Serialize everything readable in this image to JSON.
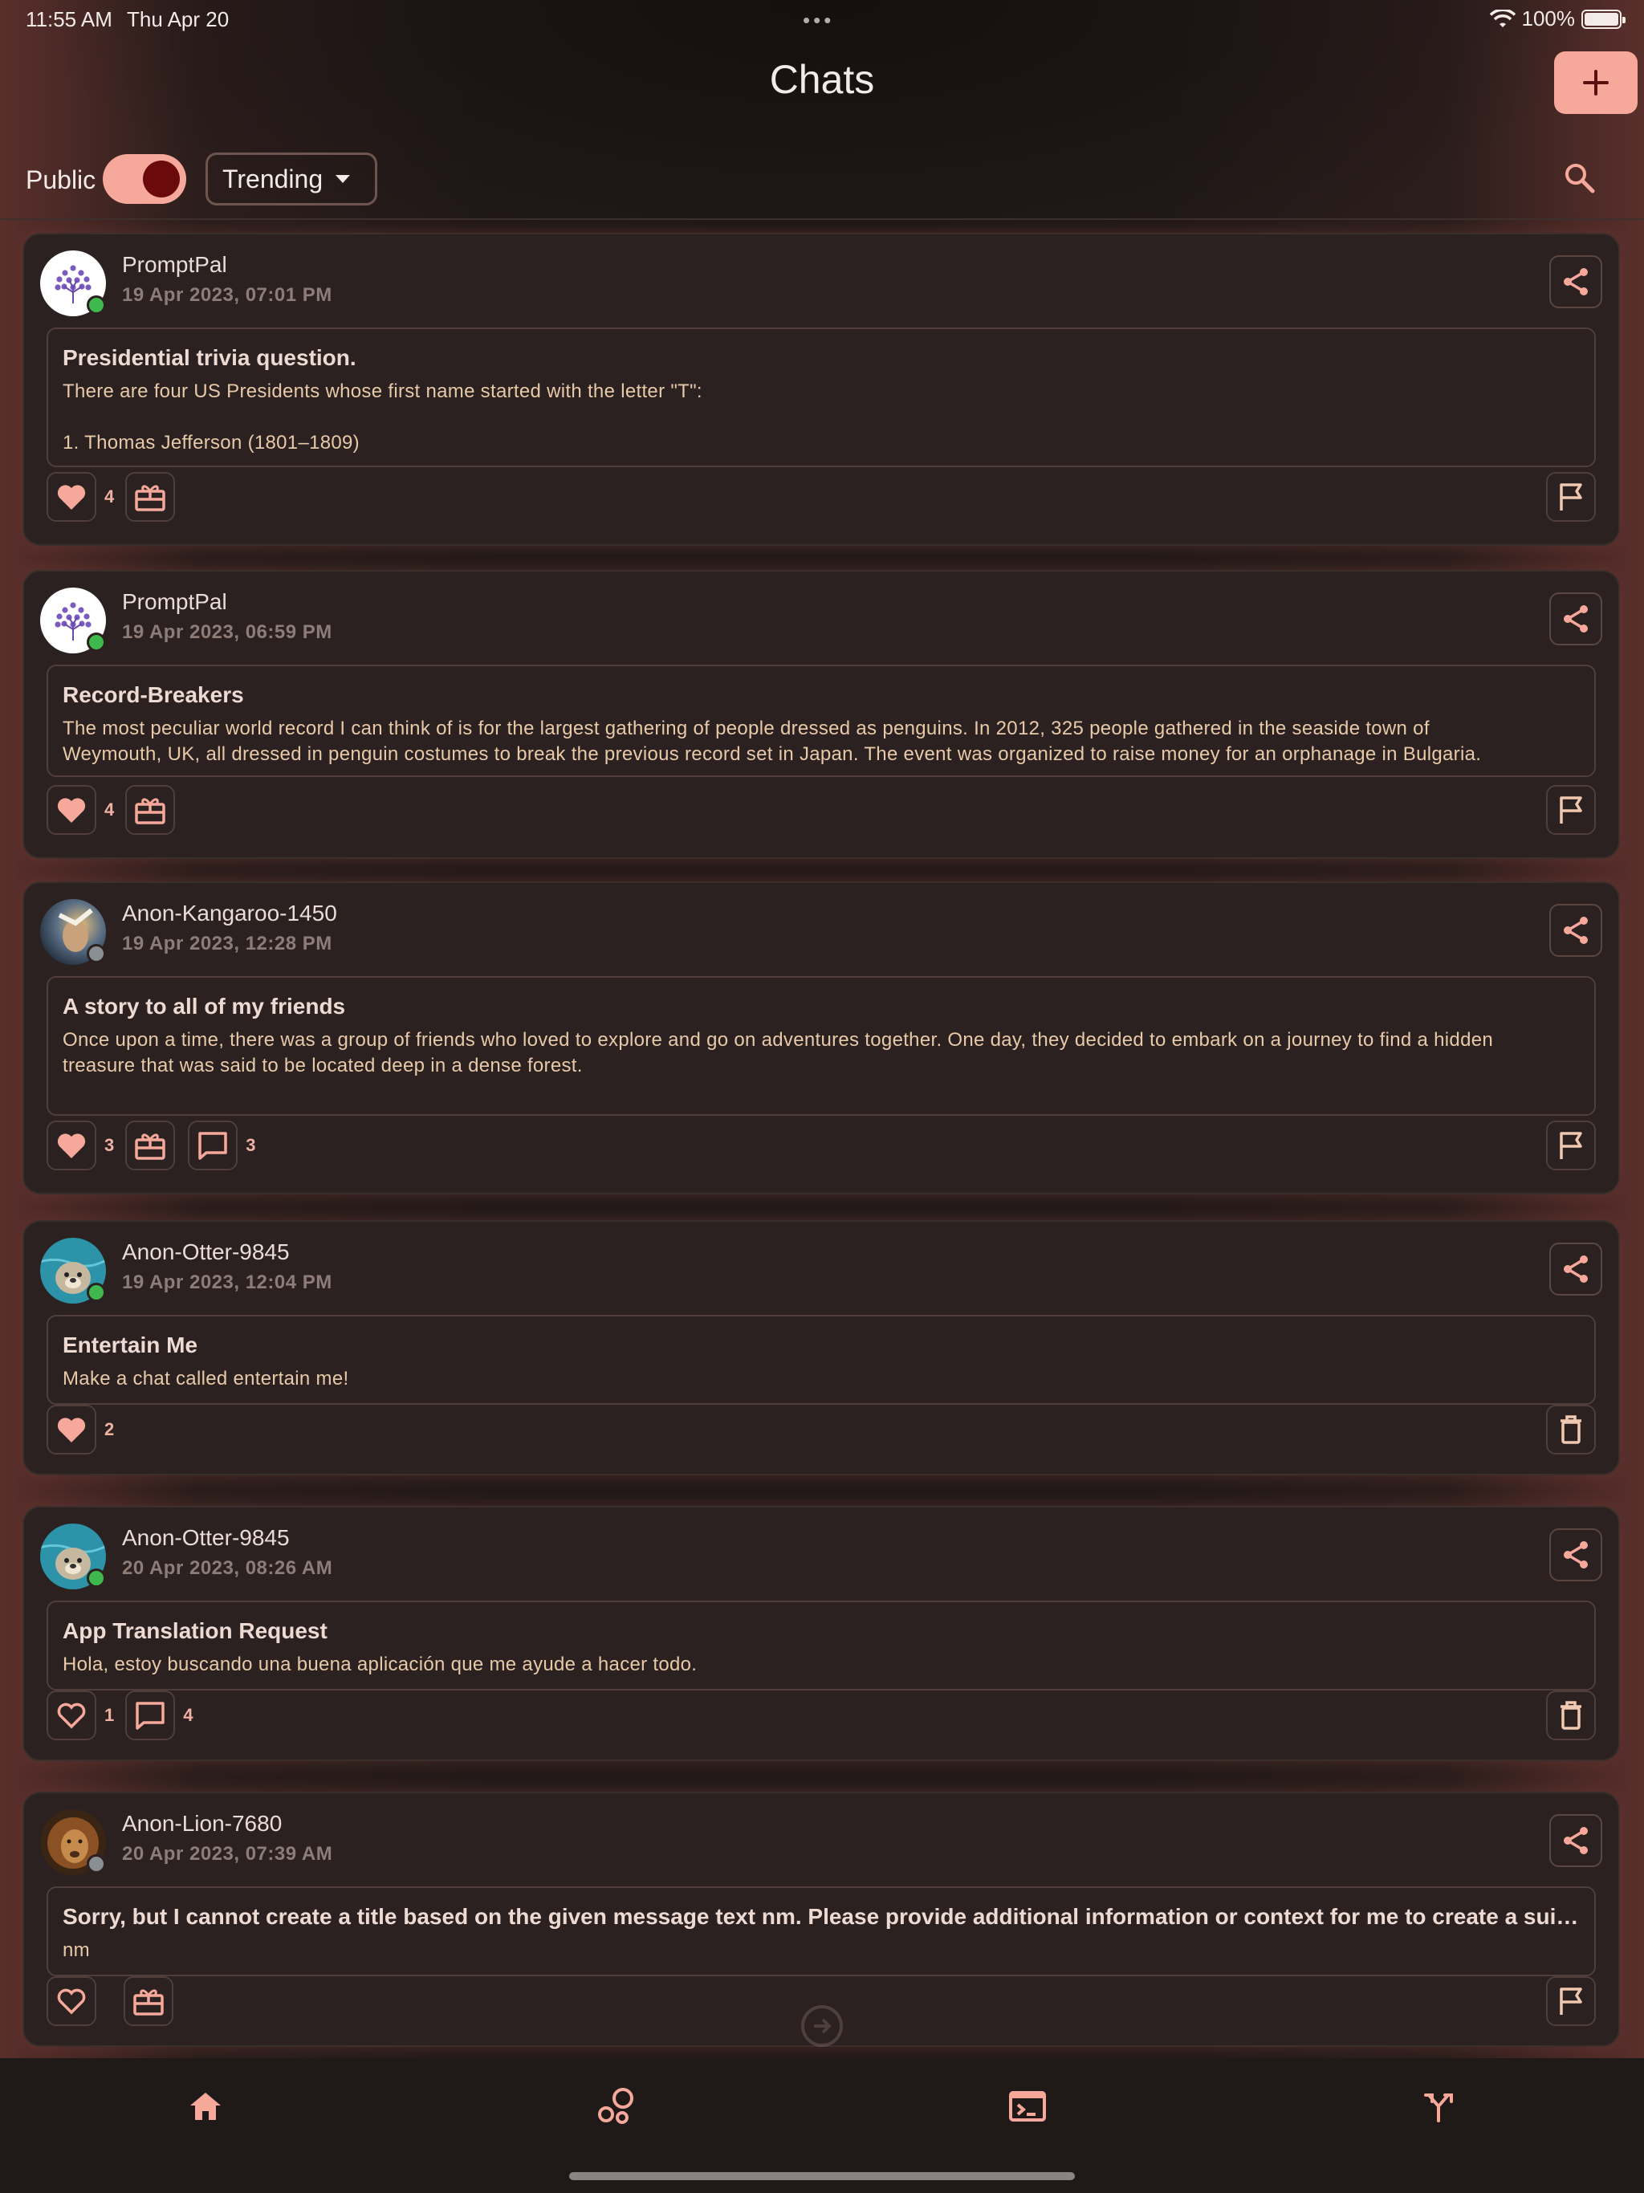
{
  "status_bar": {
    "time": "11:55 AM",
    "date": "Thu Apr 20",
    "battery": "100%"
  },
  "header": {
    "title": "Chats",
    "add_button_icon": "plus-icon"
  },
  "filters": {
    "public_label": "Public",
    "public_on": true,
    "sort_value": "Trending"
  },
  "chats": [
    {
      "user": "PromptPal",
      "timestamp": "19 Apr 2023, 07:01 PM",
      "online": true,
      "title": "Presidential trivia question.",
      "body": "There are four US Presidents whose first name started with the letter \"T\":\n\n1. Thomas Jefferson (1801–1809)",
      "likes": "4",
      "liked": true,
      "gift": true,
      "comments": "",
      "right_action": "flag"
    },
    {
      "user": "PromptPal",
      "timestamp": "19 Apr 2023, 06:59 PM",
      "online": true,
      "title": "Record-Breakers",
      "body": "The most peculiar world record I can think of is for the largest gathering of people dressed as penguins. In 2012, 325 people gathered in the seaside town of\nWeymouth, UK, all dressed in penguin costumes to break the previous record set in Japan. The event was organized to raise money for an orphanage in Bulgaria.",
      "likes": "4",
      "liked": true,
      "gift": true,
      "comments": "",
      "right_action": "flag"
    },
    {
      "user": "Anon-Kangaroo-1450",
      "timestamp": "19 Apr 2023, 12:28 PM",
      "online": false,
      "title": "A story to all of my friends",
      "body": "Once upon a time, there was a group of friends who loved to explore and go on adventures together. One day, they decided to embark on a journey to find a hidden\ntreasure that was said to be located deep in a dense forest.",
      "likes": "3",
      "liked": true,
      "gift": true,
      "comments": "3",
      "right_action": "flag"
    },
    {
      "user": "Anon-Otter-9845",
      "timestamp": "19 Apr 2023, 12:04 PM",
      "online": true,
      "title": "Entertain Me",
      "body": "Make a chat called entertain me!",
      "likes": "2",
      "liked": true,
      "gift": false,
      "comments": "",
      "right_action": "delete"
    },
    {
      "user": "Anon-Otter-9845",
      "timestamp": "20 Apr 2023, 08:26 AM",
      "online": true,
      "title": "App Translation Request",
      "body": "Hola, estoy buscando una buena aplicación que me ayude a hacer todo.",
      "likes": "1",
      "liked": false,
      "gift": false,
      "comments": "4",
      "right_action": "delete"
    },
    {
      "user": "Anon-Lion-7680",
      "timestamp": "20 Apr 2023, 07:39 AM",
      "online": false,
      "title": "Sorry, but I cannot create a title based on the given message text nm. Please provide additional information or context for me to create a suitable …",
      "body": "nm",
      "likes": "",
      "liked": false,
      "gift": true,
      "comments": "",
      "right_action": "flag"
    }
  ],
  "bottom_nav": [
    "home-icon",
    "bubbles-icon",
    "terminal-icon",
    "fork-icon"
  ],
  "colors": {
    "accent": "#f6a89a",
    "card": "#2a2120",
    "text_body": "#e8c9a8",
    "online": "#3fb94d"
  }
}
